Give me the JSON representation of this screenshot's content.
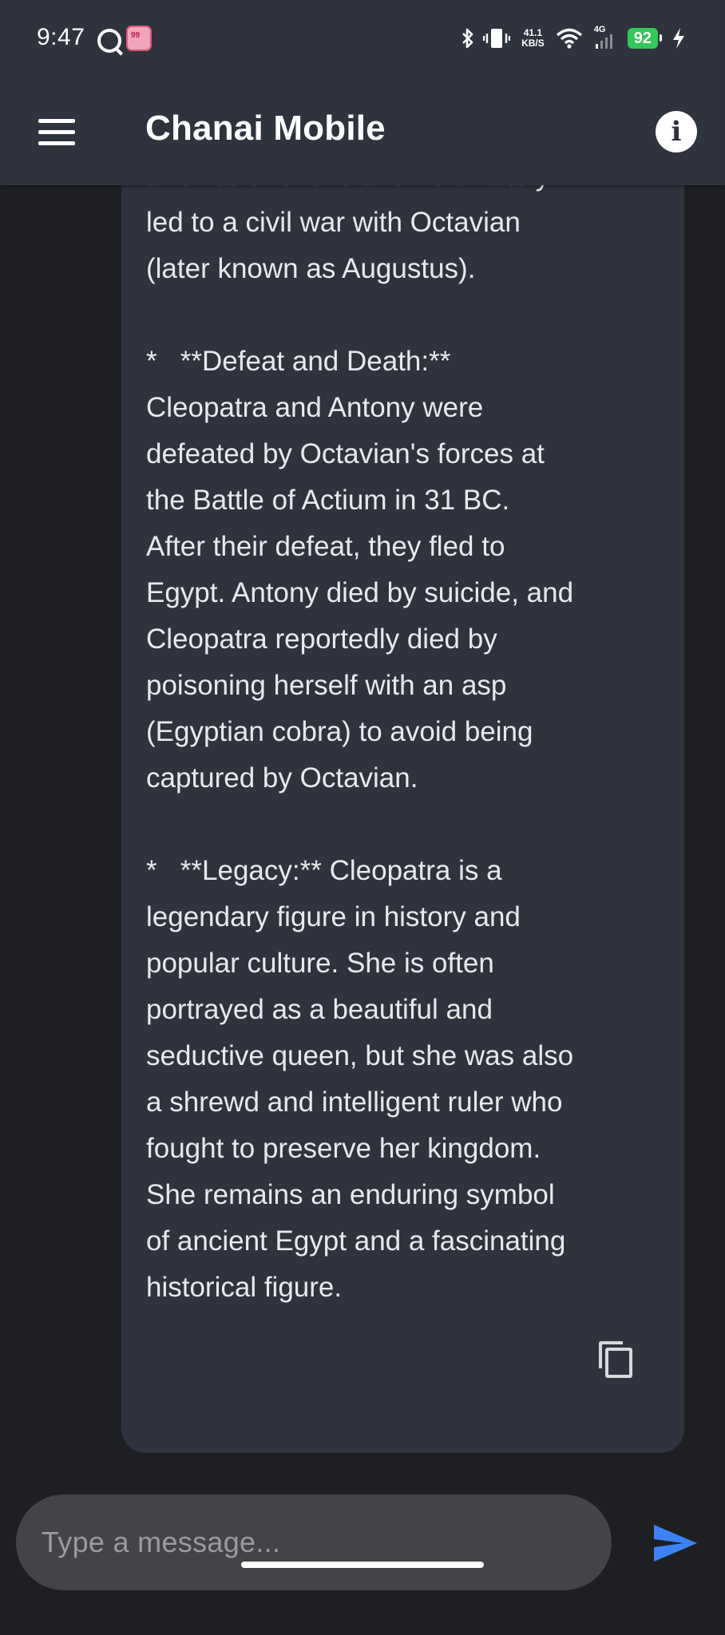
{
  "status_bar": {
    "time": "9:47",
    "app_badge": "99",
    "net_speed_value": "41.1",
    "net_speed_unit": "KB/S",
    "network_type": "4G",
    "battery": "92",
    "icons": [
      "bluetooth-icon",
      "vibrate-icon",
      "wifi-icon",
      "signal-icon",
      "charging-icon"
    ]
  },
  "app_bar": {
    "title": "Chanai Mobile",
    "menu_icon": "menu-icon",
    "info_icon": "info-icon"
  },
  "message": {
    "lines": [
      "alliance and love affair ultimately",
      "led to a civil war with Octavian",
      "(later known as Augustus).",
      "",
      "*   **Defeat and Death:**",
      "Cleopatra and Antony were",
      "defeated by Octavian's forces at",
      "the Battle of Actium in 31 BC.",
      "After their defeat, they fled to",
      "Egypt. Antony died by suicide, and",
      "Cleopatra reportedly died by",
      "poisoning herself with an asp",
      "(Egyptian cobra) to avoid being",
      "captured by Octavian.",
      "",
      "*   **Legacy:** Cleopatra is a",
      "legendary figure in history and",
      "popular culture. She is often",
      "portrayed as a beautiful and",
      "seductive queen, but she was also",
      "a shrewd and intelligent ruler who",
      "fought to preserve her kingdom.",
      "She remains an enduring symbol",
      "of ancient Egypt and a fascinating",
      "historical figure."
    ],
    "copy_icon": "copy-icon"
  },
  "composer": {
    "placeholder": "Type a message...",
    "send_icon": "send-icon"
  },
  "colors": {
    "app_bar_bg": "#2f333e",
    "chat_bg": "#1e1f23",
    "bubble_bg": "#2f333e",
    "input_bg": "#434447",
    "send_accent": "#3b82f6",
    "battery_green": "#34c759"
  }
}
